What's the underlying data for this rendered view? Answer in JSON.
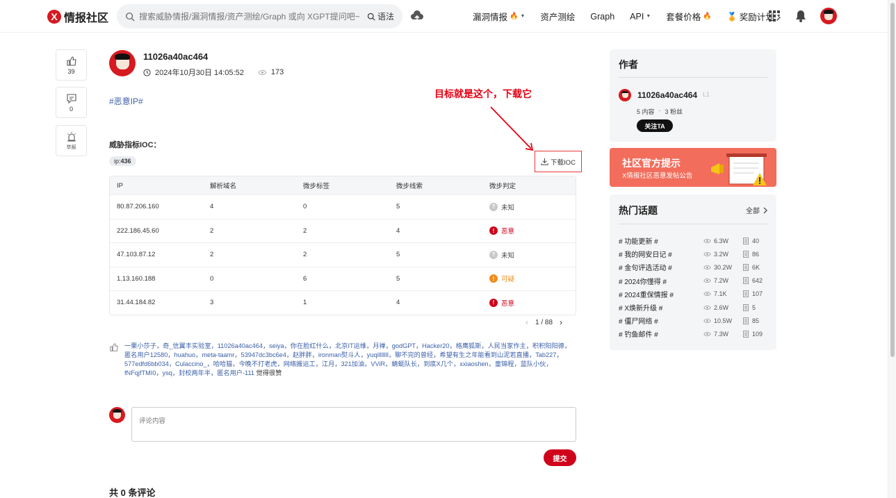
{
  "header": {
    "logo_mark": "X",
    "logo_text": "情报社区",
    "search_placeholder": "搜索威胁情报/漏洞情报/资产测绘/Graph 或向 XGPT提问吧~",
    "syntax_label": "语法",
    "nav": [
      {
        "label": "漏洞情报",
        "hot": true,
        "dropdown": true
      },
      {
        "label": "资产测绘",
        "hot": false,
        "dropdown": false
      },
      {
        "label": "Graph",
        "hot": false,
        "dropdown": false
      },
      {
        "label": "API",
        "hot": false,
        "dropdown": true
      },
      {
        "label": "套餐价格",
        "hot": true,
        "dropdown": false
      },
      {
        "label": "奖励计划",
        "hot": false,
        "dropdown": true
      }
    ]
  },
  "rail": {
    "likes": "39",
    "comments": "0",
    "report": "举报"
  },
  "post": {
    "author": "11026a40ac464",
    "datetime": "2024年10月30日 14:05:52",
    "views": "173",
    "tag": "#恶意IP#",
    "annotation": "目标就是这个，下载它",
    "ioc_title": "威胁指标IOC：",
    "ip_chip_label": "ip:",
    "ip_chip_count": "436",
    "download_label": "下载IOC"
  },
  "table": {
    "columns": [
      "IP",
      "解析域名",
      "微步标签",
      "微步线索",
      "微步判定"
    ],
    "rows": [
      {
        "ip": "80.87.206.160",
        "domains": "4",
        "tags": "0",
        "clues": "5",
        "verdict": "未知",
        "level": "unknown",
        "symbol": "?"
      },
      {
        "ip": "222.186.45.60",
        "domains": "2",
        "tags": "2",
        "clues": "4",
        "verdict": "恶意",
        "level": "mal",
        "symbol": "!"
      },
      {
        "ip": "47.103.87.12",
        "domains": "2",
        "tags": "2",
        "clues": "5",
        "verdict": "未知",
        "level": "unknown",
        "symbol": "?"
      },
      {
        "ip": "1.13.160.188",
        "domains": "0",
        "tags": "6",
        "clues": "5",
        "verdict": "可疑",
        "level": "sus",
        "symbol": "!"
      },
      {
        "ip": "31.44.184.82",
        "domains": "3",
        "tags": "1",
        "clues": "4",
        "verdict": "恶意",
        "level": "mal",
        "symbol": "!"
      }
    ],
    "page": "1 / 88"
  },
  "likes": {
    "names": "一栗小莎子，奇_信翼丰实验室，11026a40ac464，seiya，你在脸红什么，北京IT运维，月禅，godGPT，Hacker20，格鹰狐斯，人民当家作主，积积阳阳德，匿名用户12580，huahuo，meta-taamr，53947dc3bc6e4，赵胖胖，ironman熨斗人，yuqilllllll，聊不完的曾经，希望有生之年能看到山泥若直播，Tab227，577edfd6bb034，Culaccino_，哈哈猫，今晚不打老虎，网络搬运工，江月，321加油，VViR，蜻蜓队长，到底X几个，xxiaoshen，童锦程，蓝队小伙，fNFqjfTMI0，ysq，封校两年半，匿名用户-111",
    "tail": " 觉得很赞"
  },
  "comment": {
    "placeholder": "评论内容",
    "submit": "提交",
    "count_label": "共 0 条评论"
  },
  "author_card": {
    "title": "作者",
    "name": "11026a40ac464",
    "level": "L1",
    "posts": "5 内容",
    "sep": "·",
    "fans": "3 粉丝",
    "follow": "关注TA"
  },
  "banner": {
    "title": "社区官方提示",
    "subtitle": "X情报社区恶意发帖公告"
  },
  "topics": {
    "title": "热门话题",
    "all": "全部",
    "items": [
      {
        "name": "# 功能更新 #",
        "views": "6.3W",
        "posts": "40"
      },
      {
        "name": "# 我的网安日记 #",
        "views": "3.2W",
        "posts": "86"
      },
      {
        "name": "# 金句评选活动 #",
        "views": "30.2W",
        "posts": "6K"
      },
      {
        "name": "# 2024你懂得 #",
        "views": "7.2W",
        "posts": "642"
      },
      {
        "name": "# 2024重保情报 #",
        "views": "7.1K",
        "posts": "107"
      },
      {
        "name": "# X焕新升级 #",
        "views": "2.6W",
        "posts": "5"
      },
      {
        "name": "# 僵尸网络 #",
        "views": "10.5W",
        "posts": "85"
      },
      {
        "name": "# 钓鱼邮件 #",
        "views": "7.3W",
        "posts": "109"
      }
    ]
  },
  "colors": {
    "brand_red": "#d71920",
    "malicious": "#d0021b",
    "suspicious": "#f08c1a",
    "unknown": "#c8c8c8",
    "link_blue": "#3a5ea8",
    "annotation_red": "#e60012"
  }
}
